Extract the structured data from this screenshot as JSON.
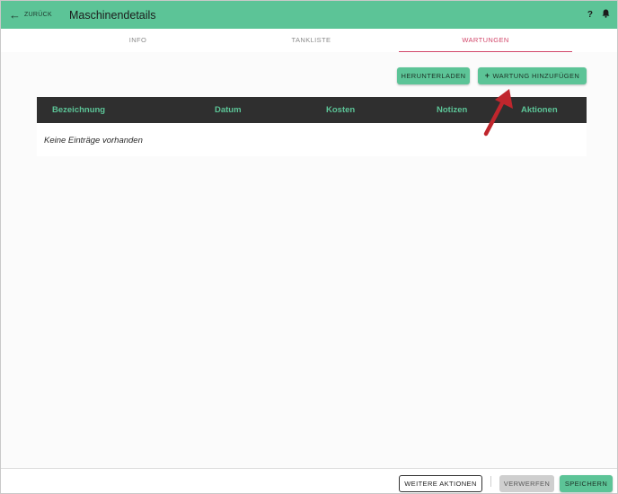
{
  "header": {
    "back_label": "ZURÜCK",
    "title": "Maschinendetails",
    "help_icon": "help-icon",
    "bell_icon": "bell-icon"
  },
  "tabs": [
    {
      "label": "INFO",
      "active": false
    },
    {
      "label": "TANKLISTE",
      "active": false
    },
    {
      "label": "WARTUNGEN",
      "active": true
    }
  ],
  "actions": {
    "download_label": "HERUNTERLADEN",
    "add_label": "WARTUNG HINZUFÜGEN",
    "add_prefix": "+"
  },
  "table": {
    "columns": [
      "Bezeichnung",
      "Datum",
      "Kosten",
      "Notizen",
      "Aktionen"
    ],
    "empty_message": "Keine Einträge vorhanden"
  },
  "footer": {
    "more_actions_label": "WEITERE AKTIONEN",
    "discard_label": "VERWERFEN",
    "save_label": "SPEICHERN"
  },
  "colors": {
    "accent": "#5cc497",
    "active_tab": "#d2476a",
    "table_header_bg": "#2f2f2f",
    "annotation_arrow": "#c0262d"
  }
}
